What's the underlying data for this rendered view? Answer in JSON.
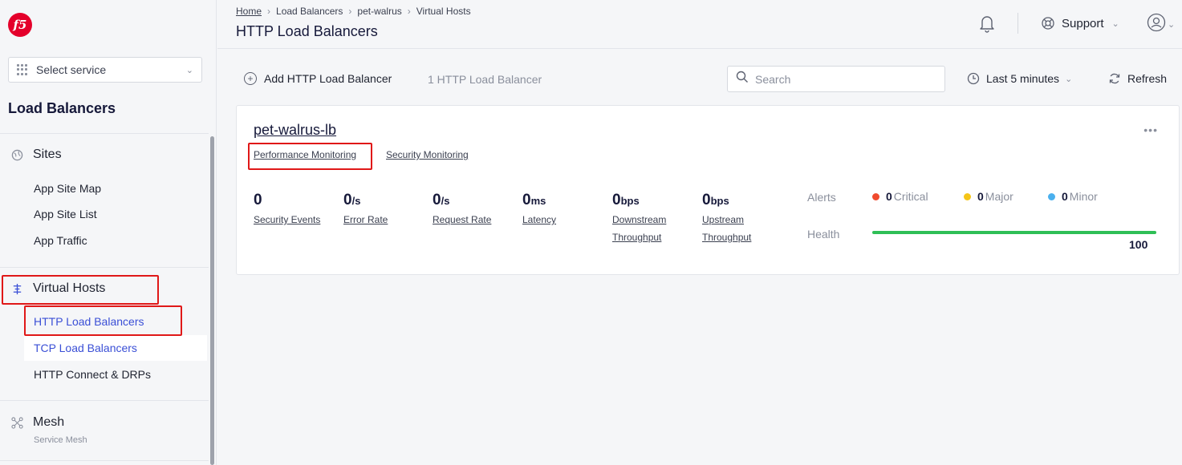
{
  "brand": {
    "logo_text": "f5"
  },
  "sidebar": {
    "select_service": "Select service",
    "title": "Load Balancers",
    "groups": [
      {
        "label": "Sites",
        "icon": "globe-icon",
        "items": [
          "App Site Map",
          "App Site List",
          "App Traffic"
        ]
      },
      {
        "label": "Virtual Hosts",
        "icon": "virtual-hosts-icon",
        "items": [
          "HTTP Load Balancers",
          "TCP Load Balancers",
          "HTTP Connect & DRPs"
        ]
      },
      {
        "label": "Mesh",
        "icon": "mesh-icon",
        "subtitle": "Service Mesh"
      }
    ],
    "active_item": "HTTP Load Balancers"
  },
  "header": {
    "breadcrumb": [
      "Home",
      "Load Balancers",
      "pet-walrus",
      "Virtual Hosts"
    ],
    "title": "HTTP Load Balancers",
    "support_label": "Support"
  },
  "toolbar": {
    "add_label": "Add HTTP Load Balancer",
    "count_label": "1 HTTP Load Balancer",
    "search_placeholder": "Search",
    "time_range": "Last 5 minutes",
    "refresh_label": "Refresh"
  },
  "card": {
    "name": "pet-walrus-lb",
    "tabs": [
      "Performance Monitoring",
      "Security Monitoring"
    ],
    "metrics": [
      {
        "value": "0",
        "unit": "",
        "label": "Security Events"
      },
      {
        "value": "0",
        "unit": "/s",
        "label": "Error Rate"
      },
      {
        "value": "0",
        "unit": "/s",
        "label": "Request Rate"
      },
      {
        "value": "0",
        "unit": "ms",
        "label": "Latency"
      },
      {
        "value": "0",
        "unit": "bps",
        "label": "Downstream Throughput"
      },
      {
        "value": "0",
        "unit": "bps",
        "label": "Upstream Throughput"
      }
    ],
    "alerts_label": "Alerts",
    "alerts": [
      {
        "count": "0",
        "label": "Critical",
        "color": "#f04a2e"
      },
      {
        "count": "0",
        "label": "Major",
        "color": "#f5c518"
      },
      {
        "count": "0",
        "label": "Minor",
        "color": "#4ab0ee"
      }
    ],
    "health_label": "Health",
    "health_value": "100",
    "health_color": "#2fbf56"
  }
}
